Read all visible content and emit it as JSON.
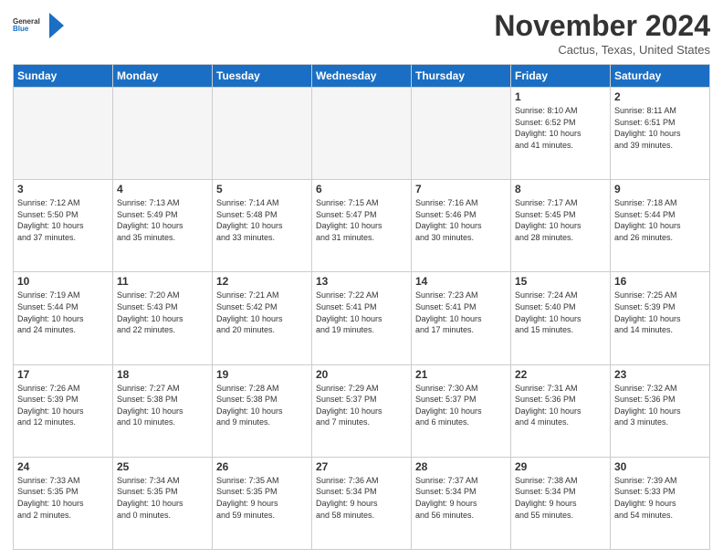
{
  "logo": {
    "line1": "General",
    "line2": "Blue"
  },
  "title": "November 2024",
  "location": "Cactus, Texas, United States",
  "days_of_week": [
    "Sunday",
    "Monday",
    "Tuesday",
    "Wednesday",
    "Thursday",
    "Friday",
    "Saturday"
  ],
  "weeks": [
    [
      {
        "day": "",
        "info": ""
      },
      {
        "day": "",
        "info": ""
      },
      {
        "day": "",
        "info": ""
      },
      {
        "day": "",
        "info": ""
      },
      {
        "day": "",
        "info": ""
      },
      {
        "day": "1",
        "info": "Sunrise: 8:10 AM\nSunset: 6:52 PM\nDaylight: 10 hours\nand 41 minutes."
      },
      {
        "day": "2",
        "info": "Sunrise: 8:11 AM\nSunset: 6:51 PM\nDaylight: 10 hours\nand 39 minutes."
      }
    ],
    [
      {
        "day": "3",
        "info": "Sunrise: 7:12 AM\nSunset: 5:50 PM\nDaylight: 10 hours\nand 37 minutes."
      },
      {
        "day": "4",
        "info": "Sunrise: 7:13 AM\nSunset: 5:49 PM\nDaylight: 10 hours\nand 35 minutes."
      },
      {
        "day": "5",
        "info": "Sunrise: 7:14 AM\nSunset: 5:48 PM\nDaylight: 10 hours\nand 33 minutes."
      },
      {
        "day": "6",
        "info": "Sunrise: 7:15 AM\nSunset: 5:47 PM\nDaylight: 10 hours\nand 31 minutes."
      },
      {
        "day": "7",
        "info": "Sunrise: 7:16 AM\nSunset: 5:46 PM\nDaylight: 10 hours\nand 30 minutes."
      },
      {
        "day": "8",
        "info": "Sunrise: 7:17 AM\nSunset: 5:45 PM\nDaylight: 10 hours\nand 28 minutes."
      },
      {
        "day": "9",
        "info": "Sunrise: 7:18 AM\nSunset: 5:44 PM\nDaylight: 10 hours\nand 26 minutes."
      }
    ],
    [
      {
        "day": "10",
        "info": "Sunrise: 7:19 AM\nSunset: 5:44 PM\nDaylight: 10 hours\nand 24 minutes."
      },
      {
        "day": "11",
        "info": "Sunrise: 7:20 AM\nSunset: 5:43 PM\nDaylight: 10 hours\nand 22 minutes."
      },
      {
        "day": "12",
        "info": "Sunrise: 7:21 AM\nSunset: 5:42 PM\nDaylight: 10 hours\nand 20 minutes."
      },
      {
        "day": "13",
        "info": "Sunrise: 7:22 AM\nSunset: 5:41 PM\nDaylight: 10 hours\nand 19 minutes."
      },
      {
        "day": "14",
        "info": "Sunrise: 7:23 AM\nSunset: 5:41 PM\nDaylight: 10 hours\nand 17 minutes."
      },
      {
        "day": "15",
        "info": "Sunrise: 7:24 AM\nSunset: 5:40 PM\nDaylight: 10 hours\nand 15 minutes."
      },
      {
        "day": "16",
        "info": "Sunrise: 7:25 AM\nSunset: 5:39 PM\nDaylight: 10 hours\nand 14 minutes."
      }
    ],
    [
      {
        "day": "17",
        "info": "Sunrise: 7:26 AM\nSunset: 5:39 PM\nDaylight: 10 hours\nand 12 minutes."
      },
      {
        "day": "18",
        "info": "Sunrise: 7:27 AM\nSunset: 5:38 PM\nDaylight: 10 hours\nand 10 minutes."
      },
      {
        "day": "19",
        "info": "Sunrise: 7:28 AM\nSunset: 5:38 PM\nDaylight: 10 hours\nand 9 minutes."
      },
      {
        "day": "20",
        "info": "Sunrise: 7:29 AM\nSunset: 5:37 PM\nDaylight: 10 hours\nand 7 minutes."
      },
      {
        "day": "21",
        "info": "Sunrise: 7:30 AM\nSunset: 5:37 PM\nDaylight: 10 hours\nand 6 minutes."
      },
      {
        "day": "22",
        "info": "Sunrise: 7:31 AM\nSunset: 5:36 PM\nDaylight: 10 hours\nand 4 minutes."
      },
      {
        "day": "23",
        "info": "Sunrise: 7:32 AM\nSunset: 5:36 PM\nDaylight: 10 hours\nand 3 minutes."
      }
    ],
    [
      {
        "day": "24",
        "info": "Sunrise: 7:33 AM\nSunset: 5:35 PM\nDaylight: 10 hours\nand 2 minutes."
      },
      {
        "day": "25",
        "info": "Sunrise: 7:34 AM\nSunset: 5:35 PM\nDaylight: 10 hours\nand 0 minutes."
      },
      {
        "day": "26",
        "info": "Sunrise: 7:35 AM\nSunset: 5:35 PM\nDaylight: 9 hours\nand 59 minutes."
      },
      {
        "day": "27",
        "info": "Sunrise: 7:36 AM\nSunset: 5:34 PM\nDaylight: 9 hours\nand 58 minutes."
      },
      {
        "day": "28",
        "info": "Sunrise: 7:37 AM\nSunset: 5:34 PM\nDaylight: 9 hours\nand 56 minutes."
      },
      {
        "day": "29",
        "info": "Sunrise: 7:38 AM\nSunset: 5:34 PM\nDaylight: 9 hours\nand 55 minutes."
      },
      {
        "day": "30",
        "info": "Sunrise: 7:39 AM\nSunset: 5:33 PM\nDaylight: 9 hours\nand 54 minutes."
      }
    ]
  ]
}
